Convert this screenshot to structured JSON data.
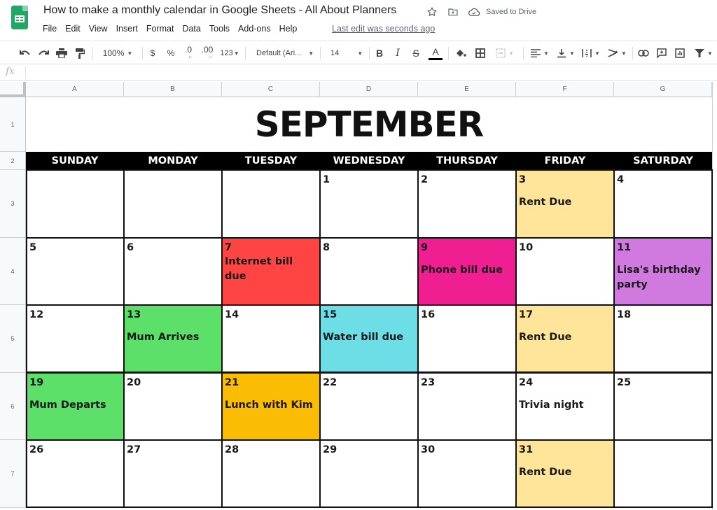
{
  "app": {
    "doc_title": "How to make a monthly calendar in Google Sheets - All About Planners",
    "saved_status": "Saved to Drive",
    "last_edit": "Last edit was seconds ago",
    "menu": [
      "File",
      "Edit",
      "View",
      "Insert",
      "Format",
      "Data",
      "Tools",
      "Add-ons",
      "Help"
    ]
  },
  "toolbar": {
    "zoom": "100%",
    "currency": "$",
    "percent": "%",
    "decrease_decimal": ".0",
    "increase_decimal": ".00",
    "more_formats": "123",
    "font": "Default (Ari...",
    "font_size": "14",
    "bold": "B",
    "italic": "I",
    "strikethrough": "S",
    "text_color": "A",
    "text_color_value": "#000000"
  },
  "formula_bar": {
    "fx": "fx",
    "value": ""
  },
  "grid": {
    "columns": [
      "A",
      "B",
      "C",
      "D",
      "E",
      "F",
      "G"
    ],
    "rows": [
      "1",
      "2",
      "3",
      "4",
      "5",
      "6",
      "7"
    ]
  },
  "calendar": {
    "month": "SEPTEMBER",
    "weekdays": [
      "SUNDAY",
      "MONDAY",
      "TUESDAY",
      "WEDNESDAY",
      "THURSDAY",
      "FRIDAY",
      "SATURDAY"
    ],
    "colors": {
      "rent": "#ffe599",
      "red": "#ff4444",
      "pink": "#f01f91",
      "purple": "#d07ae0",
      "green": "#5ce06a",
      "cyan": "#6ddde6",
      "orange": "#fbbc04",
      "white": "#ffffff"
    },
    "weeks": [
      [
        {
          "day": "",
          "event": "",
          "color": "white"
        },
        {
          "day": "",
          "event": "",
          "color": "white"
        },
        {
          "day": "",
          "event": "",
          "color": "white"
        },
        {
          "day": "1",
          "event": "",
          "color": "white"
        },
        {
          "day": "2",
          "event": "",
          "color": "white"
        },
        {
          "day": "3",
          "event": "Rent Due",
          "color": "rent"
        },
        {
          "day": "4",
          "event": "",
          "color": "white"
        }
      ],
      [
        {
          "day": "5",
          "event": "",
          "color": "white"
        },
        {
          "day": "6",
          "event": "",
          "color": "white"
        },
        {
          "day": "7",
          "event": "Internet bill due",
          "color": "red",
          "tight": true
        },
        {
          "day": "8",
          "event": "",
          "color": "white"
        },
        {
          "day": "9",
          "event": "Phone bill due",
          "color": "pink"
        },
        {
          "day": "10",
          "event": "",
          "color": "white"
        },
        {
          "day": "11",
          "event": "Lisa's birthday party",
          "color": "purple"
        }
      ],
      [
        {
          "day": "12",
          "event": "",
          "color": "white"
        },
        {
          "day": "13",
          "event": "Mum Arrives",
          "color": "green"
        },
        {
          "day": "14",
          "event": "",
          "color": "white"
        },
        {
          "day": "15",
          "event": "Water bill due",
          "color": "cyan"
        },
        {
          "day": "16",
          "event": "",
          "color": "white"
        },
        {
          "day": "17",
          "event": "Rent Due",
          "color": "rent"
        },
        {
          "day": "18",
          "event": "",
          "color": "white"
        }
      ],
      [
        {
          "day": "19",
          "event": "Mum Departs",
          "color": "green"
        },
        {
          "day": "20",
          "event": "",
          "color": "white"
        },
        {
          "day": "21",
          "event": "Lunch with Kim",
          "color": "orange"
        },
        {
          "day": "22",
          "event": "",
          "color": "white"
        },
        {
          "day": "23",
          "event": "",
          "color": "white"
        },
        {
          "day": "24",
          "event": "Trivia night",
          "color": "white"
        },
        {
          "day": "25",
          "event": "",
          "color": "white"
        }
      ],
      [
        {
          "day": "26",
          "event": "",
          "color": "white"
        },
        {
          "day": "27",
          "event": "",
          "color": "white"
        },
        {
          "day": "28",
          "event": "",
          "color": "white"
        },
        {
          "day": "29",
          "event": "",
          "color": "white"
        },
        {
          "day": "30",
          "event": "",
          "color": "white"
        },
        {
          "day": "31",
          "event": "Rent Due",
          "color": "rent"
        },
        {
          "day": "",
          "event": "",
          "color": "white"
        }
      ]
    ]
  }
}
